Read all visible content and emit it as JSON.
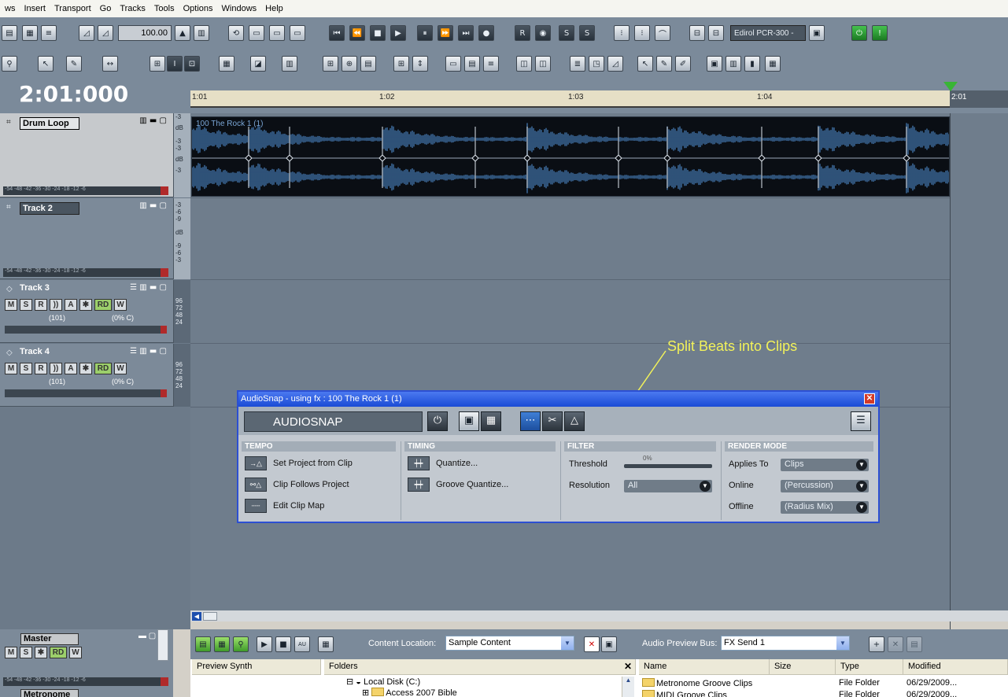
{
  "menu": [
    "ws",
    "Insert",
    "Transport",
    "Go",
    "Tracks",
    "Tools",
    "Options",
    "Windows",
    "Help"
  ],
  "toolbar": {
    "tempo": "100.00",
    "midi_device": "Edirol PCR-300 -"
  },
  "time_display": "2:01:000",
  "ruler": {
    "labels": [
      "1:01",
      "1:02",
      "1:03",
      "1:04"
    ],
    "end_label": "2:01"
  },
  "tracks": [
    {
      "name": "Drum Loop",
      "db": [
        "-3",
        "dB",
        "-3",
        "-3",
        "dB",
        "-3"
      ]
    },
    {
      "name": "Track 2",
      "db": [
        "-3",
        "-6",
        "-9",
        "dB",
        "-9",
        "-6",
        "-3"
      ]
    },
    {
      "name": "Track 3",
      "volume": "(101)",
      "pan": "(0% C)",
      "levels": [
        "96",
        "72",
        "48",
        "24"
      ]
    },
    {
      "name": "Track 4",
      "volume": "(101)",
      "pan": "(0% C)",
      "levels": [
        "96",
        "72",
        "48",
        "24"
      ]
    }
  ],
  "track_buttons": {
    "m": "M",
    "s": "S",
    "r": "R",
    "a": "A",
    "rd": "RD",
    "w": "W"
  },
  "meter_scale": "-54 -48 -42 -36 -30 -24 -18 -12 -6",
  "clip": {
    "title": "100 The Rock 1 (1)"
  },
  "audiosnap": {
    "window_title": "AudioSnap - using fx : 100 The Rock 1 (1)",
    "logo": "AUDIOSNAP",
    "tempo": {
      "title": "TEMPO",
      "set_project": "Set Project from Clip",
      "clip_follows": "Clip Follows Project",
      "edit_map": "Edit Clip Map"
    },
    "timing": {
      "title": "TIMING",
      "quantize": "Quantize...",
      "groove": "Groove Quantize..."
    },
    "filter": {
      "title": "FILTER",
      "threshold_label": "Threshold",
      "threshold_value": "0%",
      "resolution_label": "Resolution",
      "resolution_value": "All"
    },
    "render": {
      "title": "RENDER MODE",
      "applies_label": "Applies To",
      "applies_value": "Clips",
      "online_label": "Online",
      "online_value": "(Percussion)",
      "offline_label": "Offline",
      "offline_value": "(Radius Mix)"
    }
  },
  "annotation": "Split Beats into Clips",
  "master": {
    "name": "Master",
    "metronome": "Metronome",
    "buttons": {
      "m": "M",
      "s": "S",
      "rd": "RD",
      "w": "W"
    }
  },
  "browser": {
    "content_location_label": "Content Location:",
    "content_location_value": "Sample Content",
    "preview_bus_label": "Audio Preview Bus:",
    "preview_bus_value": "FX Send 1",
    "synth_header": "Preview Synth",
    "folders_header": "Folders",
    "folders": [
      "Local Disk (C:)",
      "Access 2007 Bible"
    ],
    "columns": [
      "Name",
      "Size",
      "Type",
      "Modified"
    ],
    "files": [
      {
        "name": "Metronome Groove Clips",
        "type": "File Folder",
        "modified": "06/29/2009..."
      },
      {
        "name": "MIDI Groove Clips",
        "type": "File Folder",
        "modified": "06/29/2009..."
      }
    ]
  },
  "colors": {
    "accent_blue": "#2c4fd2",
    "annotation_yellow": "#f2f25a",
    "waveform": "#3f6fa3"
  }
}
